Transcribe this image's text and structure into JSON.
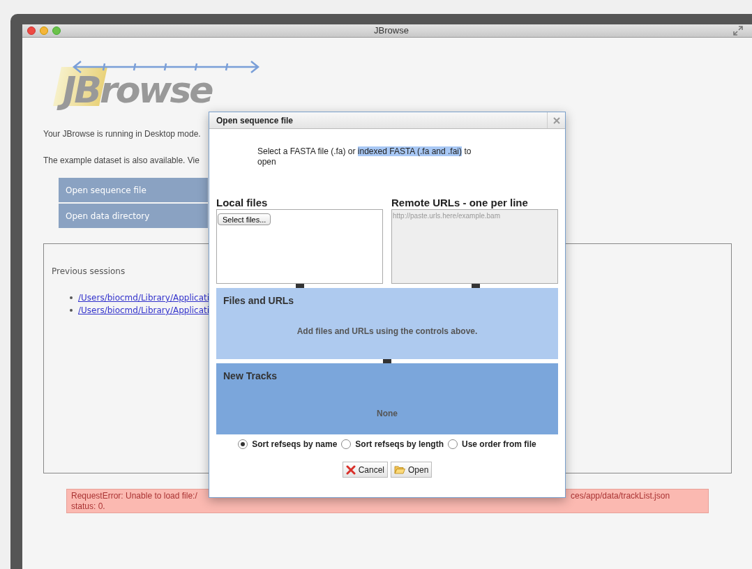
{
  "window": {
    "title": "JBrowse"
  },
  "logo": {
    "text": "JBrowse"
  },
  "page": {
    "intro": "Your JBrowse is running in Desktop mode.",
    "example_note": "The example dataset is also available. Vie",
    "actions": [
      {
        "label": "Open sequence file"
      },
      {
        "label": "Open data directory"
      }
    ],
    "sessions": {
      "label": "Previous sessions",
      "links": [
        "/Users/biocmd/Library/Applicati",
        "/Users/biocmd/Library/Applicati"
      ]
    },
    "error": {
      "left": "RequestError: Unable to load file:/",
      "right": "ces/app/data/trackList.json",
      "line2": "status: 0."
    }
  },
  "dialog": {
    "title": "Open sequence file",
    "instructions": {
      "before": "Select a FASTA file (.fa) or ",
      "highlighted": "indexed FASTA (.fa and .fai)",
      "after": " to open"
    },
    "local": {
      "heading": "Local files",
      "button": "Select files..."
    },
    "remote": {
      "heading": "Remote URLs - one per line",
      "placeholder": "http://paste.urls.here/example.bam"
    },
    "files_pane": {
      "title": "Files and URLs",
      "message": "Add files and URLs using the controls above."
    },
    "tracks_pane": {
      "title": "New Tracks",
      "message": "None"
    },
    "sort_options": [
      {
        "label": "Sort refseqs by name",
        "selected": true
      },
      {
        "label": "Sort refseqs by length",
        "selected": false
      },
      {
        "label": "Use order from file",
        "selected": false
      }
    ],
    "buttons": [
      {
        "label": "Cancel",
        "kind": "cancel"
      },
      {
        "label": "Open",
        "kind": "open"
      }
    ]
  }
}
